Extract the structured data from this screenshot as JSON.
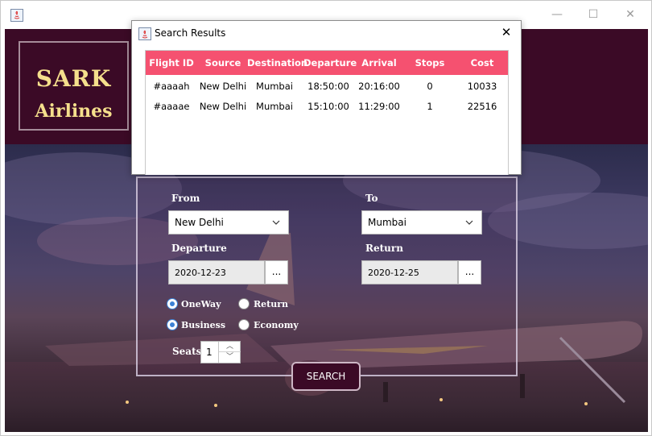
{
  "main_window": {
    "controls": {
      "minimize": "—",
      "maximize": "☐",
      "close": "✕"
    }
  },
  "logo": {
    "line1": "SARK",
    "line2": "Airlines"
  },
  "form": {
    "from_label": "From",
    "from_value": "New Delhi",
    "to_label": "To",
    "to_value": "Mumbai",
    "departure_label": "Departure",
    "departure_value": "2020-12-23",
    "return_label": "Return",
    "return_value": "2020-12-25",
    "date_button": "...",
    "trip_options": [
      {
        "label": "OneWay",
        "selected": true
      },
      {
        "label": "Return",
        "selected": false
      }
    ],
    "class_options": [
      {
        "label": "Business",
        "selected": true
      },
      {
        "label": "Economy",
        "selected": false
      }
    ],
    "seats_label": "Seats",
    "seats_value": "1",
    "search_label": "SEARCH"
  },
  "dialog": {
    "title": "Search Results",
    "close": "✕",
    "columns": [
      "Flight ID",
      "Source",
      "Destination",
      "Departure",
      "Arrival",
      "Stops",
      "Cost"
    ],
    "rows": [
      [
        "#aaaah",
        "New Delhi",
        "Mumbai",
        "18:50:00",
        "20:16:00",
        "0",
        "10033"
      ],
      [
        "#aaaae",
        "New Delhi",
        "Mumbai",
        "15:10:00",
        "11:29:00",
        "1",
        "22516"
      ]
    ]
  },
  "colors": {
    "brand_dark": "#3b0a26",
    "logo_text": "#f5df8c",
    "table_header": "#f55170",
    "radio_accent": "#3b82d6"
  }
}
